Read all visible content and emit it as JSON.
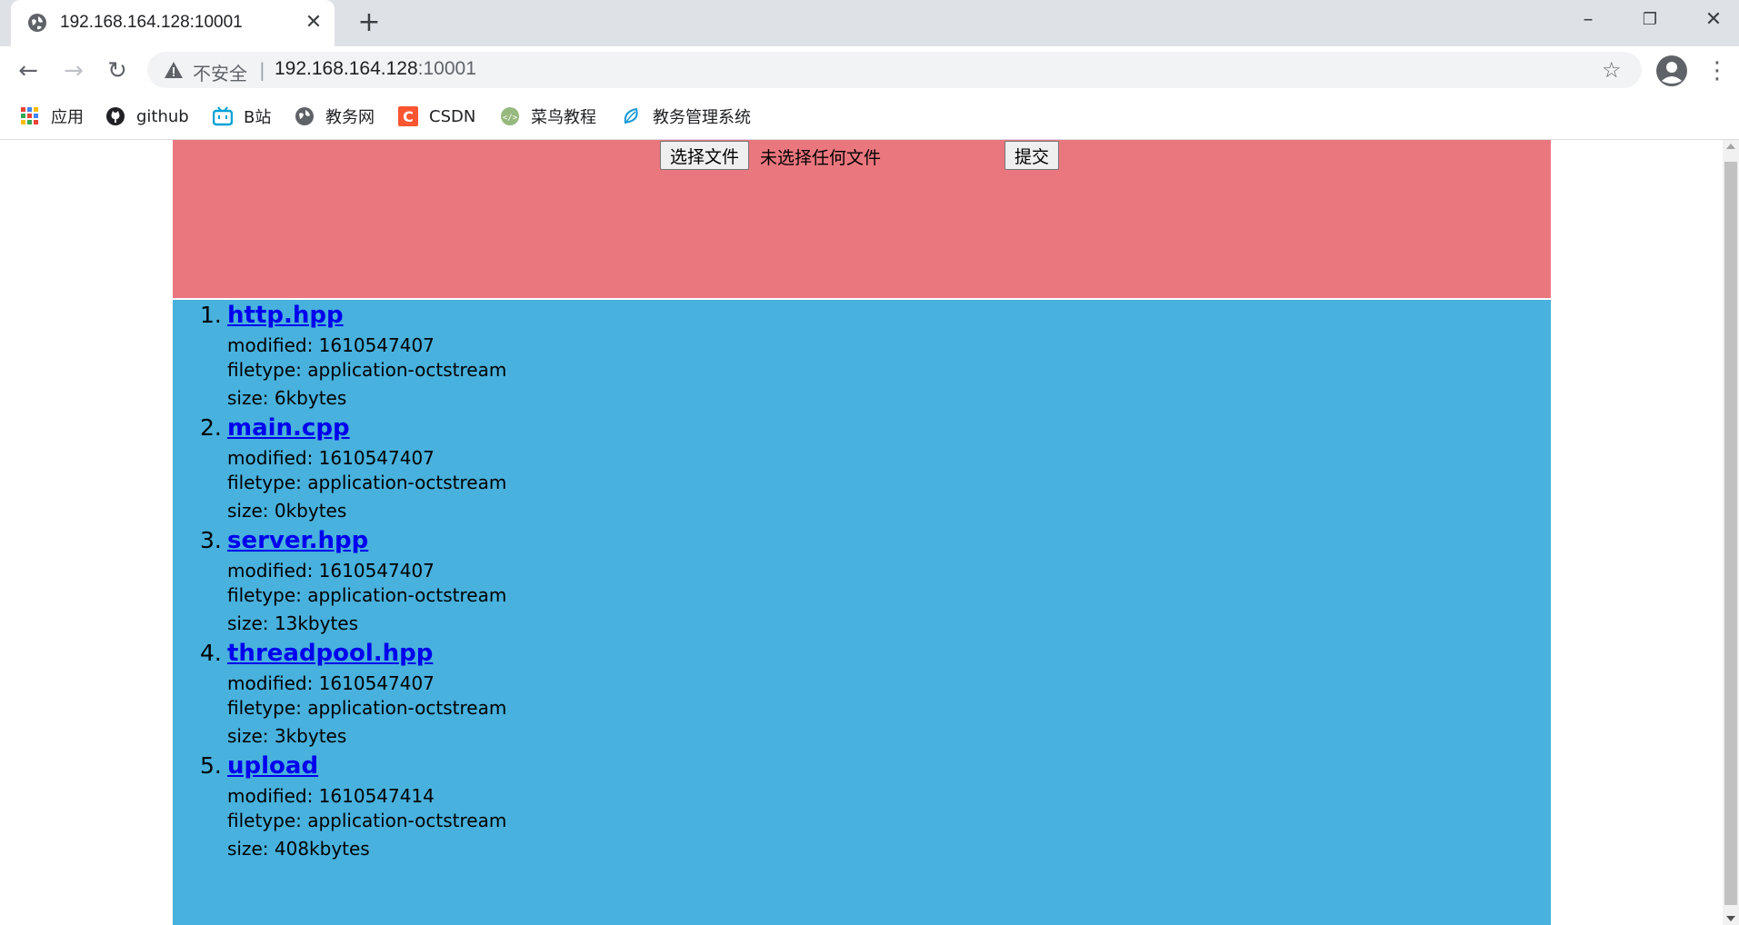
{
  "browser": {
    "tab_title": "192.168.164.128:10001",
    "security_label": "不安全",
    "url_host": "192.168.164.128",
    "url_port": ":10001",
    "bookmarks": [
      {
        "label": "应用",
        "icon": "apps-grid-icon"
      },
      {
        "label": "github",
        "icon": "github-icon"
      },
      {
        "label": "B站",
        "icon": "bilibili-icon"
      },
      {
        "label": "教务网",
        "icon": "globe-icon"
      },
      {
        "label": "CSDN",
        "icon": "csdn-icon"
      },
      {
        "label": "菜鸟教程",
        "icon": "runoob-icon"
      },
      {
        "label": "教务管理系统",
        "icon": "leaf-icon"
      }
    ]
  },
  "upload": {
    "choose_label": "选择文件",
    "no_file_label": "未选择任何文件",
    "submit_label": "提交"
  },
  "files": [
    {
      "num": "1.",
      "name": "http.hpp",
      "modified": "modified: 1610547407",
      "filetype": "filetype: application-octstream",
      "size": "size: 6kbytes"
    },
    {
      "num": "2.",
      "name": "main.cpp",
      "modified": "modified: 1610547407",
      "filetype": "filetype: application-octstream",
      "size": "size: 0kbytes"
    },
    {
      "num": "3.",
      "name": "server.hpp",
      "modified": "modified: 1610547407",
      "filetype": "filetype: application-octstream",
      "size": "size: 13kbytes"
    },
    {
      "num": "4.",
      "name": "threadpool.hpp",
      "modified": "modified: 1610547407",
      "filetype": "filetype: application-octstream",
      "size": "size: 3kbytes"
    },
    {
      "num": "5.",
      "name": "upload",
      "modified": "modified: 1610547414",
      "filetype": "filetype: application-octstream",
      "size": "size: 408kbytes"
    }
  ]
}
